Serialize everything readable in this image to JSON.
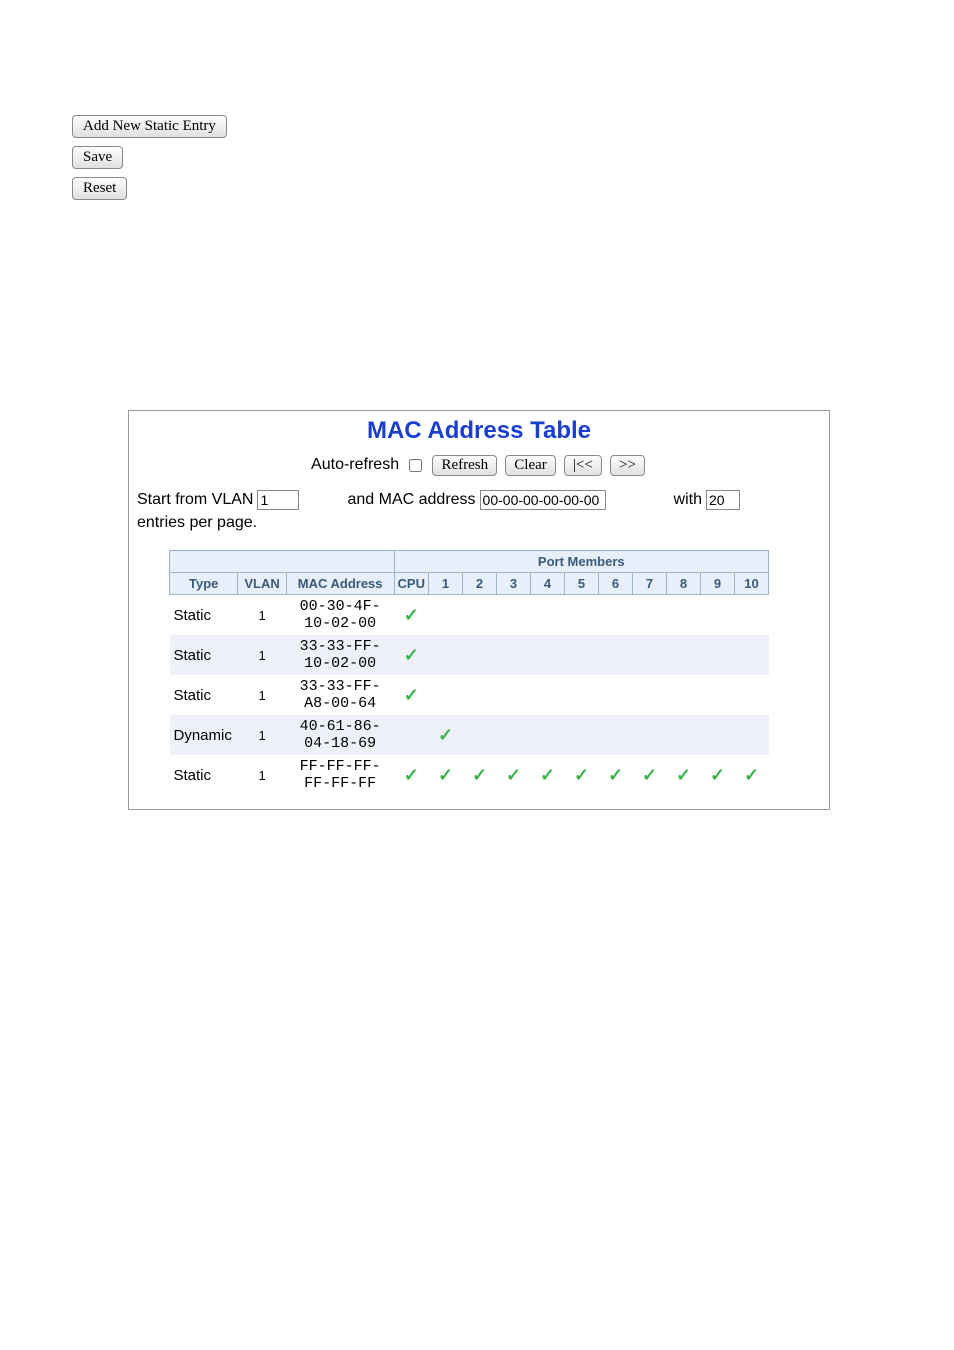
{
  "buttons": {
    "add_new": "Add New Static Entry",
    "save": "Save",
    "reset": "Reset"
  },
  "panel": {
    "title": "MAC Address Table",
    "auto_refresh_label": "Auto-refresh",
    "refresh": "Refresh",
    "clear": "Clear",
    "first": "|<<",
    "next": ">>",
    "filter": {
      "start_vlan_label": "Start from VLAN",
      "vlan_value": "1",
      "and_mac_label": "and MAC address",
      "mac_value": "00-00-00-00-00-00",
      "with_label": "with",
      "count_value": "20",
      "entries_label": "entries per page."
    },
    "headers": {
      "port_members": "Port Members",
      "type": "Type",
      "vlan": "VLAN",
      "mac": "MAC Address",
      "cpu": "CPU",
      "ports": [
        "1",
        "2",
        "3",
        "4",
        "5",
        "6",
        "7",
        "8",
        "9",
        "10"
      ]
    },
    "rows": [
      {
        "type": "Static",
        "vlan": "1",
        "mac": "00-30-4F-10-02-00",
        "cpu": true,
        "ports": [
          false,
          false,
          false,
          false,
          false,
          false,
          false,
          false,
          false,
          false
        ]
      },
      {
        "type": "Static",
        "vlan": "1",
        "mac": "33-33-FF-10-02-00",
        "cpu": true,
        "ports": [
          false,
          false,
          false,
          false,
          false,
          false,
          false,
          false,
          false,
          false
        ]
      },
      {
        "type": "Static",
        "vlan": "1",
        "mac": "33-33-FF-A8-00-64",
        "cpu": true,
        "ports": [
          false,
          false,
          false,
          false,
          false,
          false,
          false,
          false,
          false,
          false
        ]
      },
      {
        "type": "Dynamic",
        "vlan": "1",
        "mac": "40-61-86-04-18-69",
        "cpu": false,
        "ports": [
          true,
          false,
          false,
          false,
          false,
          false,
          false,
          false,
          false,
          false
        ]
      },
      {
        "type": "Static",
        "vlan": "1",
        "mac": "FF-FF-FF-FF-FF-FF",
        "cpu": true,
        "ports": [
          true,
          true,
          true,
          true,
          true,
          true,
          true,
          true,
          true,
          true
        ]
      }
    ]
  }
}
